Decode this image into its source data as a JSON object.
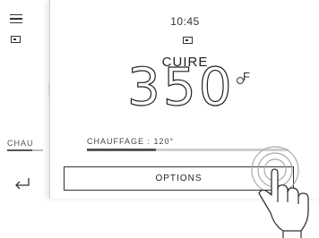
{
  "status": {
    "time": "10:45"
  },
  "cooking": {
    "mode": "CUIRE",
    "temperature": "350",
    "unit": "F"
  },
  "background_panel": {
    "label": "CHAU"
  },
  "heating": {
    "label": "CHAUFFAGE : 120°",
    "progress": 0.34
  },
  "actions": {
    "options_label": "OPTIONS"
  },
  "icons": {
    "menu": "menu-icon",
    "oven": "oven-icon",
    "back": "back-arrow-icon",
    "tap": "hand-tap-icon"
  }
}
